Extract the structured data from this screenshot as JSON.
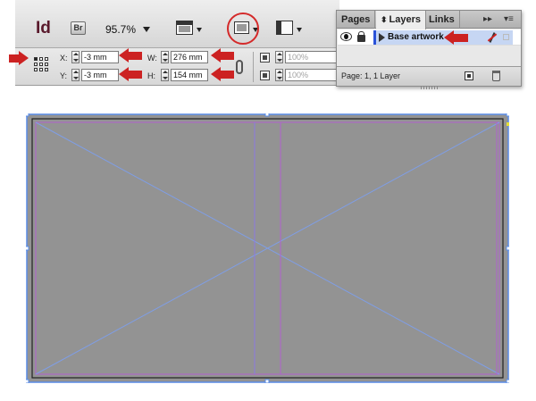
{
  "app": {
    "logo": "Id",
    "bridge_label": "Br",
    "zoom": "95.7%"
  },
  "control_bar": {
    "x_label": "X:",
    "y_label": "Y:",
    "w_label": "W:",
    "h_label": "H:",
    "x_value": "-3 mm",
    "y_value": "-3 mm",
    "w_value": "276 mm",
    "h_value": "154 mm",
    "scale_x": "100%",
    "scale_y": "100%"
  },
  "layers_panel": {
    "tabs": [
      {
        "label": "Pages",
        "active": false
      },
      {
        "label": "Layers",
        "active": true
      },
      {
        "label": "Links",
        "active": false
      }
    ],
    "layers": [
      {
        "name": "Base artwork",
        "visible": true,
        "locked": true,
        "color": "#2b52d8"
      }
    ],
    "status": "Page: 1, 1 Layer"
  },
  "colors": {
    "annotation": "#cc2222",
    "canvas": "#939393",
    "margin_guide": "#b062cf",
    "frame_cross": "#7f9ee6",
    "selection": "#5a8ce6"
  }
}
